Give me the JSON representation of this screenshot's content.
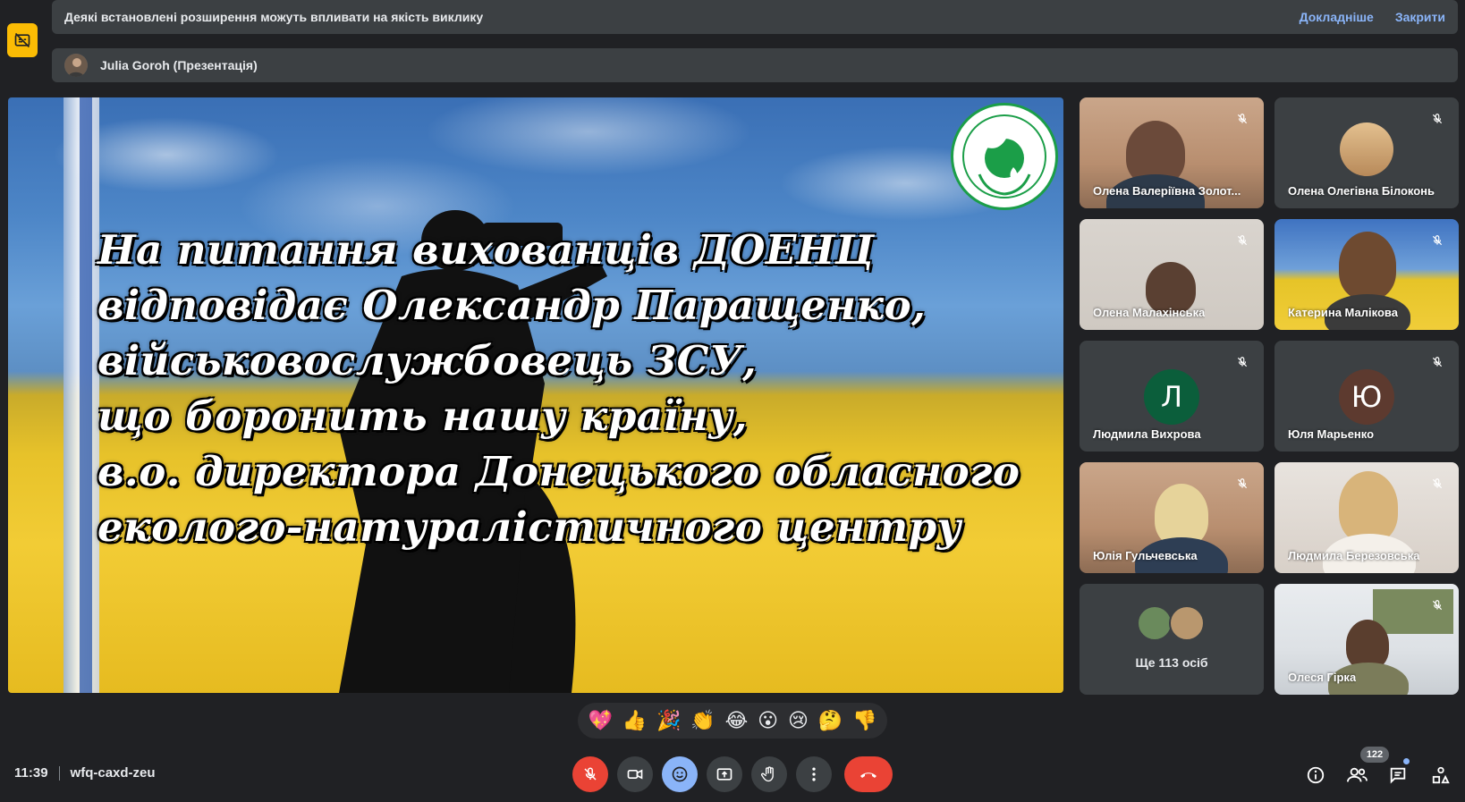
{
  "banner": {
    "message": "Деякі встановлені розширення можуть впливати на якість виклику",
    "more_link": "Докладніше",
    "close_link": "Закрити"
  },
  "presenter": {
    "label": "Julia Goroh (Презентація)"
  },
  "slide": {
    "lines": [
      "На питання вихованців ДОЕНЦ",
      "відповідає Олександр Паращенко,",
      "військовослужбовець ЗСУ,",
      "що боронить нашу країну,",
      "в.о. директора Донецького обласного",
      "еколого-натуралістичного центру"
    ]
  },
  "participants": [
    {
      "name": "Олена Валеріївна Золот...",
      "muted": true
    },
    {
      "name": "Олена Олегівна Білоконь",
      "muted": true
    },
    {
      "name": "Олена Малахінська",
      "muted": true
    },
    {
      "name": "Катерина Малікова",
      "muted": true
    },
    {
      "name": "Людмила Вихрова",
      "muted": true,
      "initial": "Л",
      "color": "#0b5e3b"
    },
    {
      "name": "Юля Марьенко",
      "muted": true,
      "initial": "Ю",
      "color": "#5d3a2f"
    },
    {
      "name": "Юлія Гульчевська",
      "muted": true
    },
    {
      "name": "Людмила Березовська",
      "muted": true
    },
    {
      "name": "Олеся Гірка",
      "muted": true
    }
  ],
  "more_people": "Ще 113 осіб",
  "reactions": [
    "💖",
    "👍",
    "🎉",
    "👏",
    "😂",
    "😮",
    "😢",
    "🤔",
    "👎"
  ],
  "meeting": {
    "time": "11:39",
    "code": "wfq-caxd-zeu"
  },
  "people_count": "122",
  "colors": {
    "background": "#202124",
    "surface": "#3c4043",
    "accent": "#8ab4f8",
    "danger": "#ea4335",
    "badge": "#fbbc04"
  },
  "icons": [
    "captions-off-icon",
    "mic-off-icon",
    "camera-icon",
    "emoji-icon",
    "present-icon",
    "raise-hand-icon",
    "more-vert-icon",
    "end-call-icon",
    "info-icon",
    "people-icon",
    "chat-icon",
    "activities-icon"
  ]
}
